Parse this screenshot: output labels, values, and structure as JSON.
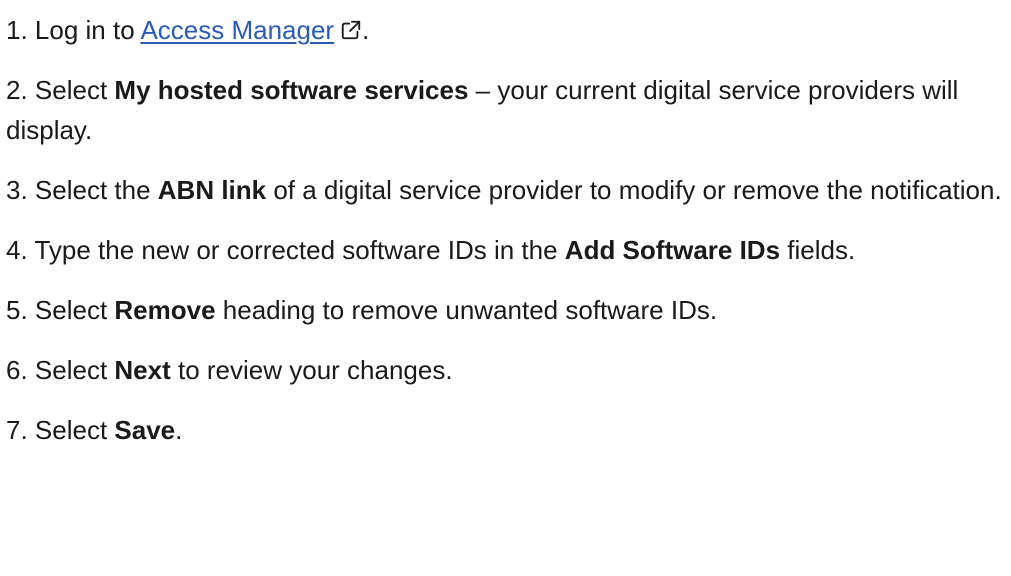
{
  "steps": [
    {
      "prefix": "1. Log in to ",
      "link_text": "Access Manager",
      "link_icon": "external-link-icon",
      "suffix": "."
    },
    {
      "prefix": "2. Select ",
      "bold": "My hosted software services",
      "suffix": " – your current digital service providers will display."
    },
    {
      "prefix": "3. Select the ",
      "bold": "ABN link",
      "suffix": " of a digital service provider to modify or remove the notification."
    },
    {
      "prefix": "4. Type the new or corrected software IDs in the ",
      "bold": "Add Software IDs",
      "suffix": " fields."
    },
    {
      "prefix": "5. Select ",
      "bold": "Remove",
      "suffix": " heading to remove unwanted software IDs."
    },
    {
      "prefix": "6. Select ",
      "bold": "Next",
      "suffix": " to review your changes."
    },
    {
      "prefix": "7. Select ",
      "bold": "Save",
      "suffix": "."
    }
  ],
  "colors": {
    "text": "#1a1a1a",
    "link": "#2a5bb5"
  }
}
